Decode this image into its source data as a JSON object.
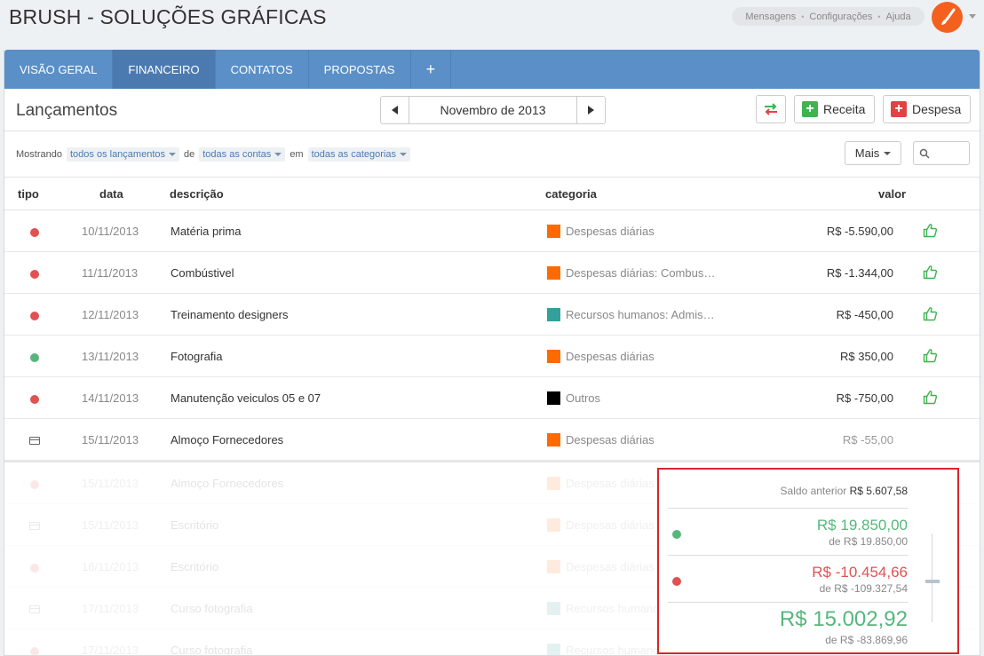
{
  "app": {
    "title": "BRUSH - SOLUÇÕES GRÁFICAS"
  },
  "top_links": [
    "Mensagens",
    "Configurações",
    "Ajuda"
  ],
  "tabs": [
    {
      "label": "VISÃO GERAL"
    },
    {
      "label": "FINANCEIRO",
      "active": true
    },
    {
      "label": "CONTATOS"
    },
    {
      "label": "PROPOSTAS"
    },
    {
      "label": "+"
    }
  ],
  "toolbar": {
    "title": "Lançamentos",
    "month": "Novembro de 2013",
    "receita_label": "Receita",
    "despesa_label": "Despesa"
  },
  "filters": {
    "prefix": "Mostrando",
    "launches": "todos os lançamentos",
    "de": "de",
    "accounts": "todas as contas",
    "em": "em",
    "categories": "todas as categorias",
    "mais_label": "Mais"
  },
  "table": {
    "headers": {
      "tipo": "tipo",
      "data": "data",
      "descricao": "descrição",
      "categoria": "categoria",
      "valor": "valor"
    },
    "rows": [
      {
        "type": "expense",
        "date": "10/11/2013",
        "desc": "Matéria prima",
        "cat": "Despesas diárias",
        "cat_color": "#ff6a00",
        "value": "R$ -5.590,00",
        "confirmed": true
      },
      {
        "type": "expense",
        "date": "11/11/2013",
        "desc": "Combústivel",
        "cat": "Despesas diárias: Combus…",
        "cat_color": "#ff6a00",
        "value": "R$ -1.344,00",
        "confirmed": true
      },
      {
        "type": "expense",
        "date": "12/11/2013",
        "desc": "Treinamento designers",
        "cat": "Recursos humanos: Admis…",
        "cat_color": "#33a09c",
        "value": "R$ -450,00",
        "confirmed": true
      },
      {
        "type": "income",
        "date": "13/11/2013",
        "desc": "Fotografia",
        "cat": "Despesas diárias",
        "cat_color": "#ff6a00",
        "value": "R$ 350,00",
        "confirmed": true
      },
      {
        "type": "expense",
        "date": "14/11/2013",
        "desc": "Manutenção veiculos 05 e 07",
        "cat": "Outros",
        "cat_color": "#000000",
        "value": "R$ -750,00",
        "confirmed": true
      },
      {
        "type": "card",
        "date": "15/11/2013",
        "desc": "Almoço Fornecedores",
        "cat": "Despesas diárias",
        "cat_color": "#ff6a00",
        "value": "R$ -55,00",
        "confirmed": false
      }
    ],
    "faded_rows": [
      {
        "type": "expense",
        "date": "15/11/2013",
        "desc": "Almoço Fornecedores",
        "cat": "Despesas diárias",
        "cat_color": "#ff6a00"
      },
      {
        "type": "card",
        "date": "15/11/2013",
        "desc": "Escritório",
        "cat": "Despesas diárias",
        "cat_color": "#ff6a00"
      },
      {
        "type": "expense",
        "date": "16/11/2013",
        "desc": "Escritório",
        "cat": "Despesas diárias",
        "cat_color": "#ff6a00"
      },
      {
        "type": "card",
        "date": "17/11/2013",
        "desc": "Curso fotografia",
        "cat": "Recursos humanos: Admis…",
        "cat_color": "#33a09c"
      },
      {
        "type": "expense",
        "date": "17/11/2013",
        "desc": "Curso fotografia",
        "cat": "Recursos humanos: Admis…",
        "cat_color": "#33a09c"
      }
    ]
  },
  "summary": {
    "prev_label": "Saldo anterior",
    "prev_value": "R$ 5.607,58",
    "income": "R$ 19.850,00",
    "income_sub": "de R$ 19.850,00",
    "expense": "R$ -10.454,66",
    "expense_sub": "de R$ -109.327,54",
    "total": "R$ 15.002,92",
    "total_sub": "de R$ -83.869,96"
  },
  "colors": {
    "income": "#55b77b",
    "expense": "#e05252",
    "tab_bar": "#5a8fc7",
    "tab_active": "#4b7ab0",
    "highlight": "#d9252a"
  },
  "icons": [
    "brush-icon",
    "transfer-icon",
    "plus-icon",
    "search-icon",
    "thumbs-up-icon",
    "card-icon"
  ]
}
